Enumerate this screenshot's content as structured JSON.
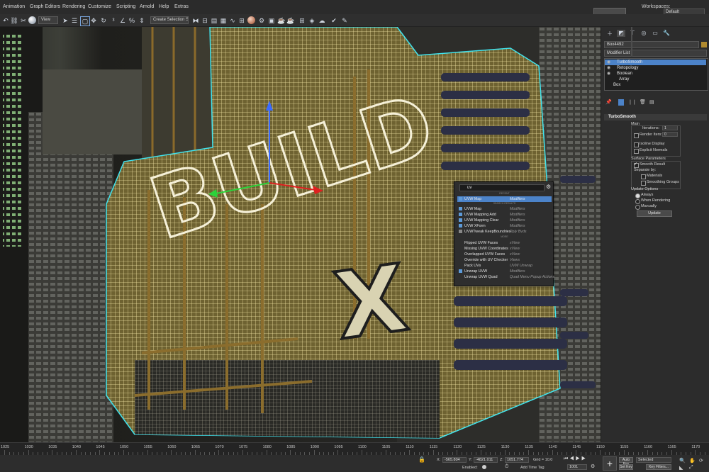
{
  "menu": [
    "Animation",
    "Graph Editors",
    "Rendering",
    "Customize",
    "Scripting",
    "Arnold",
    "Help",
    "Extras"
  ],
  "workspaces": {
    "label": "Workspaces:",
    "value": "Default"
  },
  "toolbar": {
    "view_combo": "View",
    "selection_set": "Create Selection Se"
  },
  "viewport": {
    "sign_text": "BUILD",
    "sign_x": "X"
  },
  "command_panel": {
    "object_name": "Box4492",
    "modifier_list": "Modifier List",
    "stack": [
      {
        "label": "TurboSmooth",
        "selected": true
      },
      {
        "label": "Retopology",
        "selected": false
      },
      {
        "label": "Boolean",
        "selected": false
      },
      {
        "label": "Array",
        "selected": false
      },
      {
        "label": "Box",
        "selected": false
      }
    ],
    "rollout_title": "TurboSmooth",
    "main_label": "Main",
    "iterations_label": "Iterations:",
    "iterations_value": "1",
    "render_iters_label": "Render Iters:",
    "render_iters_value": "0",
    "isoline_label": "Isoline Display",
    "explicit_normals_label": "Explicit Normals",
    "surface_params_label": "Surface Parameters",
    "smooth_result_label": "Smooth Result",
    "separate_by_label": "Separate by:",
    "materials_label": "Materials",
    "smoothing_groups_label": "Smoothing Groups",
    "update_options_label": "Update Options",
    "always_label": "Always",
    "when_rendering_label": "When Rendering",
    "manually_label": "Manually",
    "update_button": "Update"
  },
  "search_popup": {
    "query": "uv",
    "section_recent": "RECENT",
    "section_search": "SEARCH RESULTS",
    "section_more": "MORE",
    "items": [
      {
        "label": "UVW Map",
        "category": "Modifiers",
        "highlighted": true
      },
      {
        "label": "UVW Map",
        "category": "Modifiers",
        "highlighted": false
      },
      {
        "label": "UVW Mapping Add",
        "category": "Modifiers",
        "highlighted": false
      },
      {
        "label": "UVW Mapping Clear",
        "category": "Modifiers",
        "highlighted": false
      },
      {
        "label": "UVW XForm",
        "category": "Modifiers",
        "highlighted": false
      },
      {
        "label": "UVWTweak KeepBoundries...",
        "category": "Poly Bvds",
        "highlighted": false
      },
      {
        "label": "Flipped UVW Faces",
        "category": "xView",
        "highlighted": false
      },
      {
        "label": "Missing UVW Coordinates",
        "category": "xView",
        "highlighted": false
      },
      {
        "label": "Overlapped UVW Faces",
        "category": "xView",
        "highlighted": false
      },
      {
        "label": "Override with UV Checker",
        "category": "Views",
        "highlighted": false
      },
      {
        "label": "Pack UVs",
        "category": "UVW Unwrap",
        "highlighted": false
      },
      {
        "label": "Unwrap UVW",
        "category": "Modifiers",
        "highlighted": false
      },
      {
        "label": "Unwrap UVW Quad",
        "category": "Quad Menu Popup Actions",
        "highlighted": false
      }
    ]
  },
  "timeline": {
    "ticks": [
      "1025",
      "1030",
      "1035",
      "1040",
      "1045",
      "1050",
      "1055",
      "1060",
      "1065",
      "1070",
      "1075",
      "1080",
      "1085",
      "1090",
      "1095",
      "1100",
      "1105",
      "1110",
      "1115",
      "1120",
      "1125",
      "1130",
      "1135",
      "1140",
      "1145",
      "1150",
      "1155",
      "1160",
      "1165",
      "1170"
    ]
  },
  "status": {
    "x_label": "X:",
    "x_value": "-565.804",
    "y_label": "Y:",
    "y_value": "-4821.011",
    "z_label": "Z:",
    "z_value": "1051.774",
    "grid": "Grid = 10.0",
    "enabled_label": "Enabled:",
    "add_time_tag": "Add Time Tag",
    "frame_value": "1001",
    "auto_key": "Auto Key",
    "set_key": "Set Key",
    "selected_value": "Selected",
    "key_filters": "Key Filters..."
  },
  "colors": {
    "accent": "#4c83c9",
    "wire": "#e8d98f",
    "cyan": "#3fe3ee"
  }
}
